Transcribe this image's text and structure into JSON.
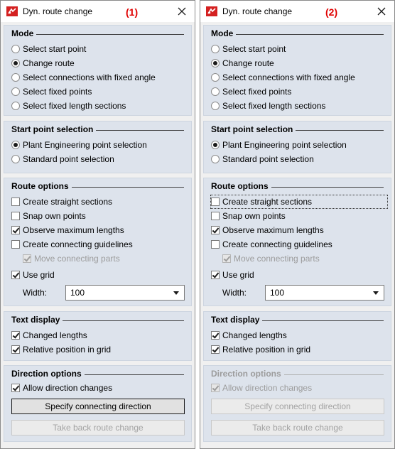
{
  "window_title": "Dyn. route change",
  "panels": [
    {
      "number": "(1)",
      "mode": {
        "heading": "Mode",
        "options": [
          "Select start point",
          "Change route",
          "Select connections with fixed angle",
          "Select fixed points",
          "Select fixed length sections"
        ],
        "selected": "Change route"
      },
      "start_point": {
        "heading": "Start point selection",
        "options": [
          "Plant Engineering point selection",
          "Standard point selection"
        ],
        "selected": "Plant Engineering point selection"
      },
      "route_options": {
        "heading": "Route options",
        "create_straight": "Create straight sections",
        "snap_own": "Snap own points",
        "observe_max": "Observe maximum lengths",
        "create_guidelines": "Create connecting guidelines",
        "move_parts": "Move connecting parts",
        "use_grid": "Use grid",
        "width_label": "Width:",
        "width_value": "100"
      },
      "text_display": {
        "heading": "Text display",
        "changed_lengths": "Changed lengths",
        "relative_position": "Relative position in grid"
      },
      "direction_options": {
        "heading": "Direction options",
        "allow_changes": "Allow direction changes",
        "specify_button": "Specify connecting direction",
        "take_back_button": "Take back route change"
      }
    },
    {
      "number": "(2)",
      "mode": {
        "heading": "Mode",
        "options": [
          "Select start point",
          "Change route",
          "Select connections with fixed angle",
          "Select fixed points",
          "Select fixed length sections"
        ],
        "selected": "Change route"
      },
      "start_point": {
        "heading": "Start point selection",
        "options": [
          "Plant Engineering point selection",
          "Standard point selection"
        ],
        "selected": "Plant Engineering point selection"
      },
      "route_options": {
        "heading": "Route options",
        "create_straight": "Create straight sections",
        "snap_own": "Snap own points",
        "observe_max": "Observe maximum lengths",
        "create_guidelines": "Create connecting guidelines",
        "move_parts": "Move connecting parts",
        "use_grid": "Use grid",
        "width_label": "Width:",
        "width_value": "100"
      },
      "text_display": {
        "heading": "Text display",
        "changed_lengths": "Changed lengths",
        "relative_position": "Relative position in grid"
      },
      "direction_options": {
        "heading": "Direction options",
        "allow_changes": "Allow direction changes",
        "specify_button": "Specify connecting direction",
        "take_back_button": "Take back route change"
      }
    }
  ],
  "colors": {
    "number_red": "#e00000",
    "group_bg": "#dde3ec"
  }
}
